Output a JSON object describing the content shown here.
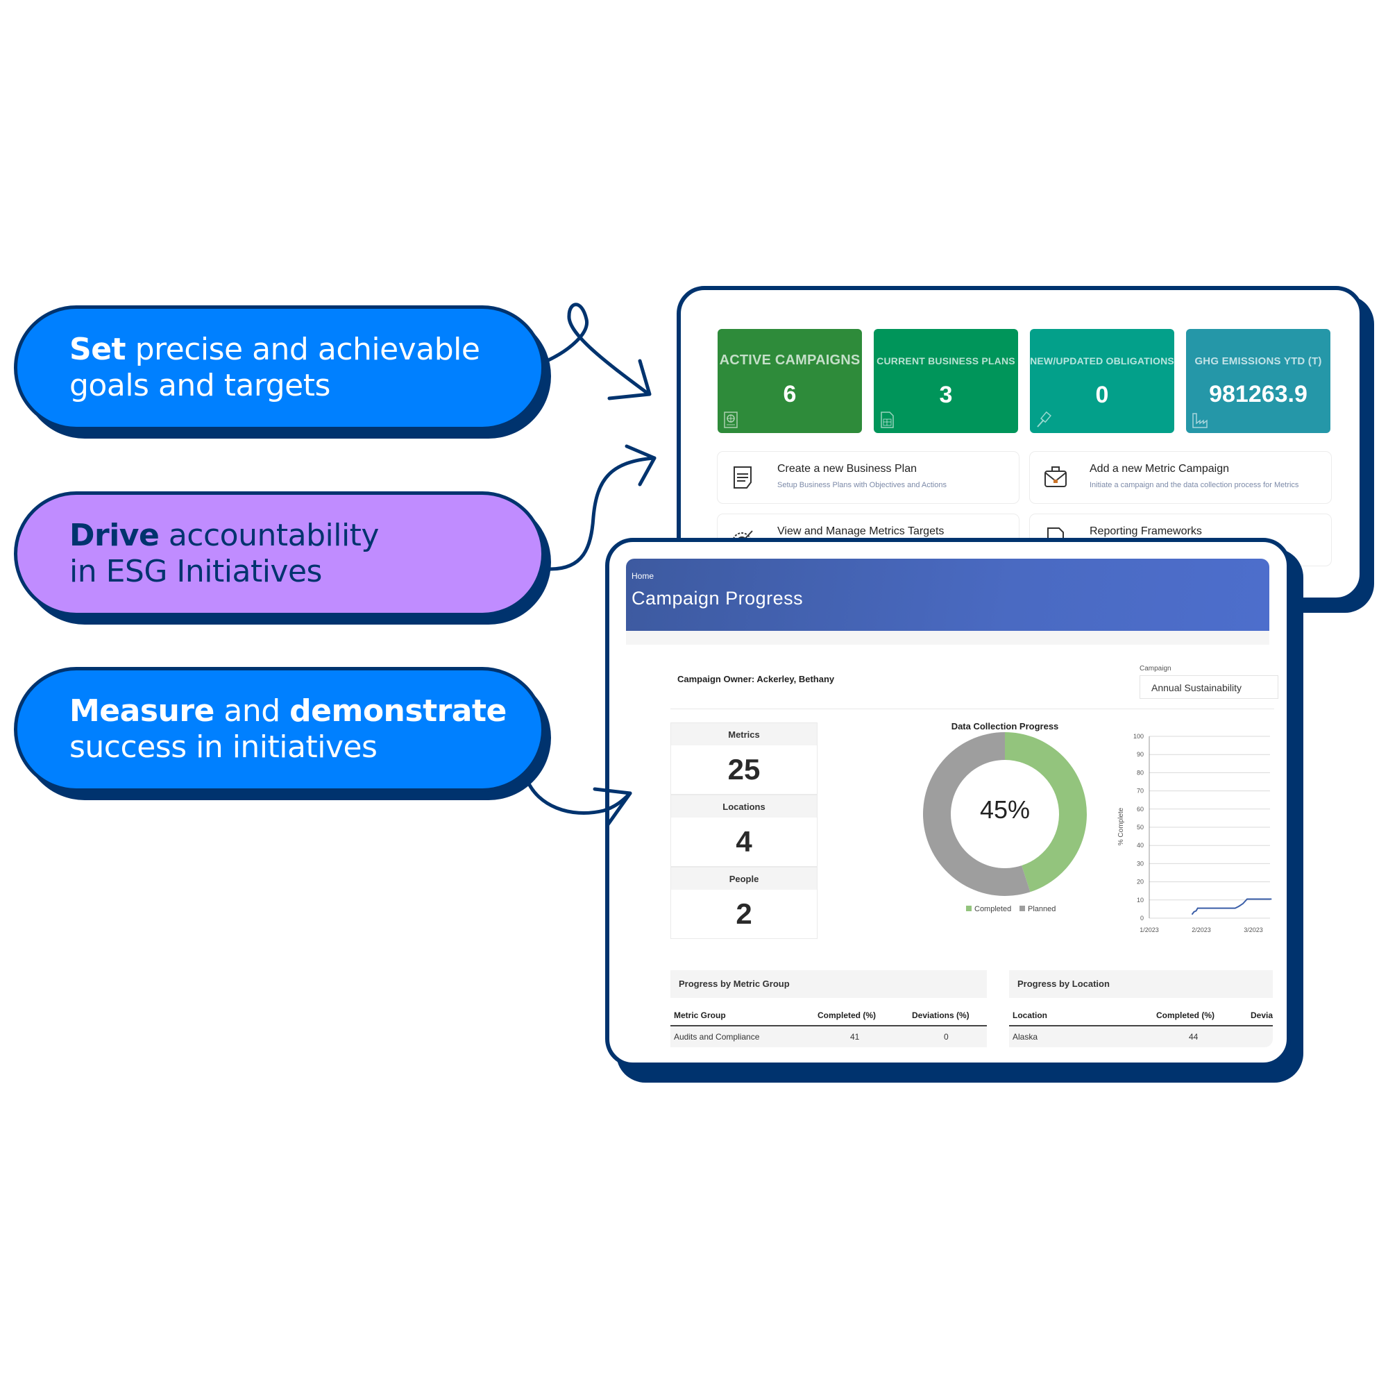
{
  "callouts": [
    {
      "bold": "Set",
      "rest_line1": " precise and achievable",
      "line2": "goals and targets",
      "color": "#0080ff"
    },
    {
      "bold": "Drive",
      "rest_line1": " accountability",
      "line2": "in ESG Initiatives",
      "color": "#c08cff"
    },
    {
      "bold1": "Measure",
      "mid": " and ",
      "bold2": "demonstrate",
      "line2": "success in initiatives",
      "color": "#0080ff"
    }
  ],
  "dashboard": {
    "tiles": [
      {
        "label": "ACTIVE CAMPAIGNS",
        "value": "6",
        "icon": "passport-globe-icon",
        "color": "#2e8b3a"
      },
      {
        "label": "CURRENT BUSINESS PLANS",
        "value": "3",
        "icon": "spreadsheet-doc-icon",
        "color": "#00955a"
      },
      {
        "label": "NEW/UPDATED OBLIGATIONS",
        "value": "0",
        "icon": "gavel-icon",
        "color": "#03a08a"
      },
      {
        "label": "GHG EMISSIONS YTD (T)",
        "value": "981263.9",
        "icon": "factory-icon",
        "color": "#2597a8"
      }
    ],
    "actions": [
      {
        "title": "Create a new Business Plan",
        "subtitle": "Setup Business Plans with Objectives and Actions",
        "icon": "document-icon"
      },
      {
        "title": "Add a new Metric Campaign",
        "subtitle": "Initiate a campaign and the data collection process for Metrics",
        "icon": "briefcase-icon"
      },
      {
        "title": "View and Manage Metrics Targets",
        "subtitle": "",
        "icon": "target-icon"
      },
      {
        "title": "Reporting Frameworks",
        "subtitle": "",
        "icon": "report-chart-icon"
      }
    ]
  },
  "campaign": {
    "breadcrumb": "Home",
    "title": "Campaign Progress",
    "owner": "Campaign Owner: Ackerley, Bethany",
    "select_label": "Campaign",
    "select_value": "Annual Sustainability",
    "stats": [
      {
        "label": "Metrics",
        "value": "25"
      },
      {
        "label": "Locations",
        "value": "4"
      },
      {
        "label": "People",
        "value": "2"
      }
    ],
    "metric_group_table": {
      "title": "Progress by Metric Group",
      "columns": [
        "Metric Group",
        "Completed (%)",
        "Deviations (%)"
      ],
      "rows": [
        [
          "Audits and Compliance",
          "41",
          "0"
        ]
      ]
    },
    "location_table": {
      "title": "Progress by Location",
      "columns": [
        "Location",
        "Completed (%)",
        "Devia"
      ],
      "rows": [
        [
          "Alaska",
          "44",
          ""
        ]
      ]
    }
  },
  "chart_data": [
    {
      "type": "pie",
      "title": "Data Collection Progress",
      "center_label": "45%",
      "slices": [
        {
          "name": "Completed",
          "value": 45,
          "color": "#93c47d"
        },
        {
          "name": "Planned",
          "value": 55,
          "color": "#9e9e9e"
        }
      ],
      "legend": [
        "Completed",
        "Planned"
      ],
      "legend_position": "bottom"
    },
    {
      "type": "line",
      "title": "",
      "xlabel": "",
      "ylabel": "% Complete",
      "ylim": [
        0,
        100
      ],
      "yticks": [
        0,
        10,
        20,
        30,
        40,
        50,
        60,
        70,
        80,
        90,
        100
      ],
      "xtick_labels": [
        "1/2023",
        "2/2023",
        "3/2023"
      ],
      "grid": true,
      "series": [
        {
          "name": "% Complete",
          "color": "#3a5ea8",
          "points": [
            [
              0.82,
              2
            ],
            [
              0.86,
              3.5
            ],
            [
              0.9,
              4
            ],
            [
              0.93,
              5.5
            ],
            [
              1.0,
              5.5
            ],
            [
              1.5,
              5.5
            ],
            [
              1.65,
              5.5
            ],
            [
              1.72,
              6.5
            ],
            [
              1.8,
              8
            ],
            [
              1.88,
              10.5
            ],
            [
              2.0,
              10.5
            ],
            [
              2.35,
              10.5
            ]
          ]
        }
      ]
    }
  ]
}
